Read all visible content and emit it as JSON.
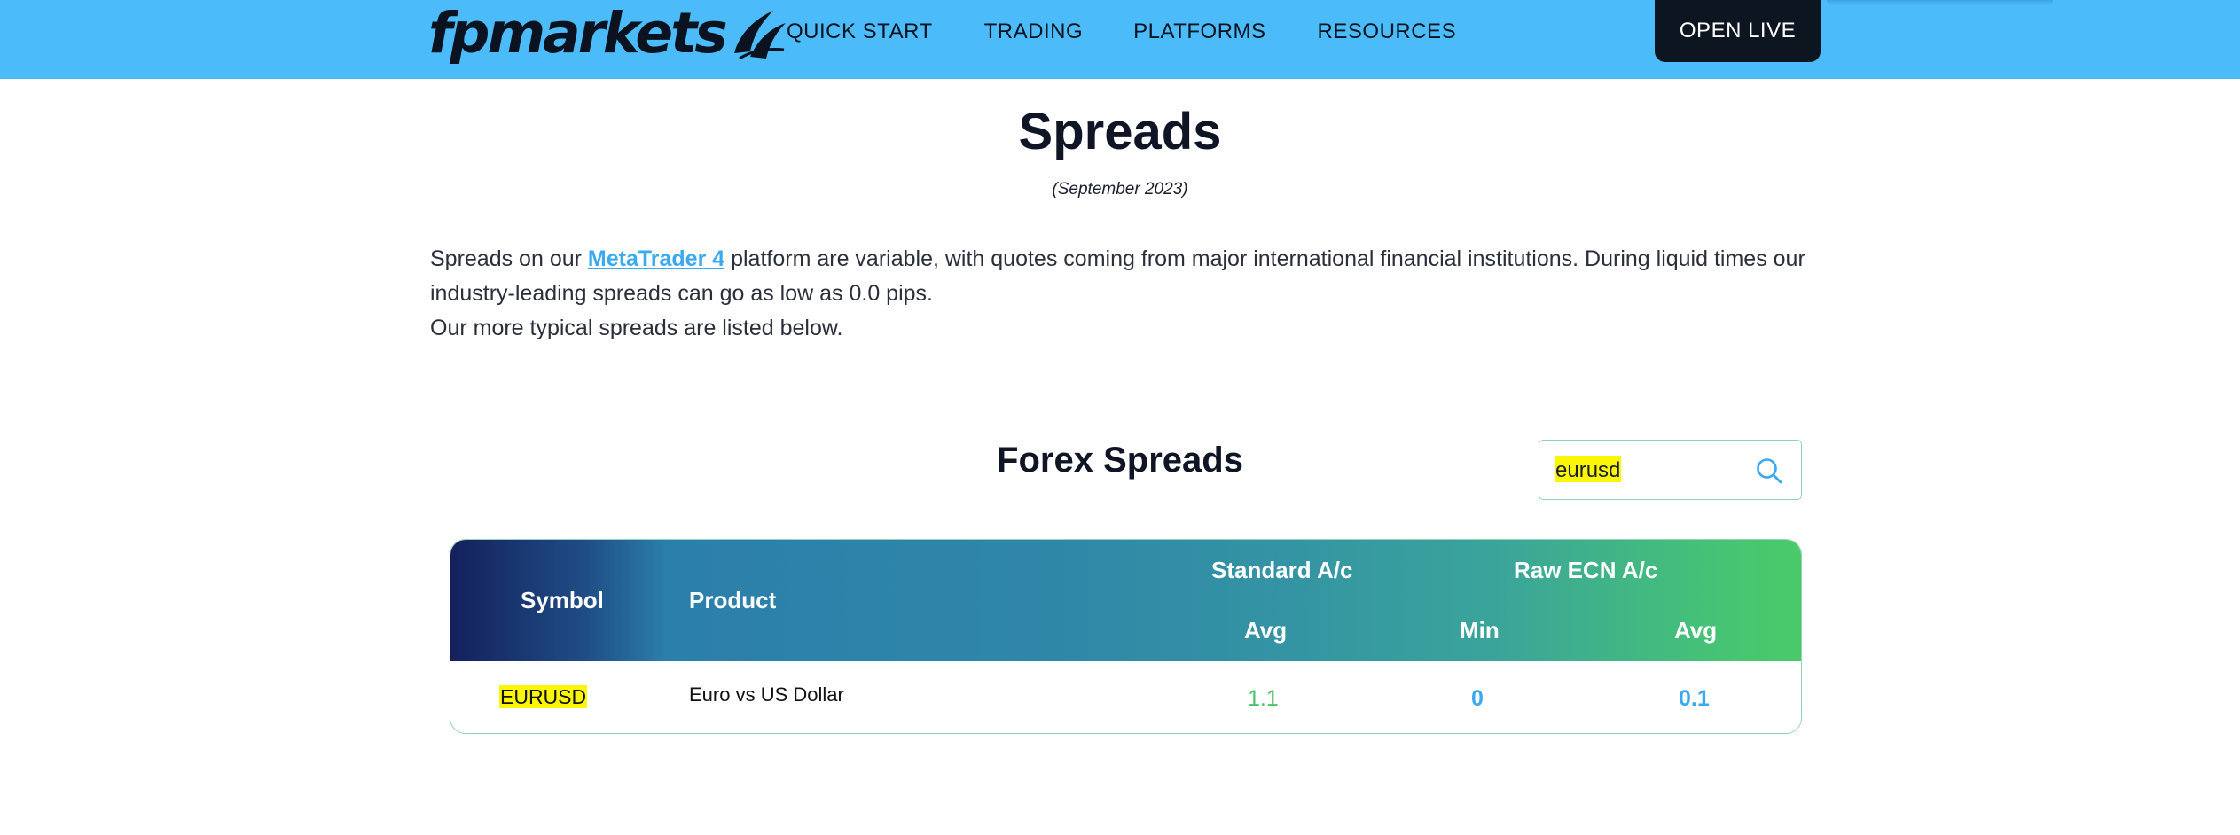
{
  "header": {
    "logo_text": "fpmarkets",
    "nav": [
      "QUICK START",
      "TRADING",
      "PLATFORMS",
      "RESOURCES"
    ],
    "cta_label": "OPEN LIVE",
    "color": "#4bbcf9"
  },
  "page": {
    "title": "Spreads",
    "date": "(September 2023)",
    "intro_before_link": "Spreads on our ",
    "intro_link": "MetaTrader 4",
    "intro_after_link": " platform are variable, with quotes coming from major international financial institutions. During liquid times our industry-leading spreads can go as low as 0.0 pips.",
    "intro_line2": "Our more typical spreads are listed below."
  },
  "forex": {
    "section_title": "Forex Spreads",
    "search_value": "eurusd",
    "search_icon": "search-icon",
    "columns": {
      "symbol": "Symbol",
      "product": "Product",
      "standard_group": "Standard A/c",
      "raw_group": "Raw ECN A/c",
      "standard_avg": "Avg",
      "raw_min": "Min",
      "raw_avg": "Avg"
    },
    "rows": [
      {
        "symbol": "EURUSD",
        "product": "Euro vs US Dollar",
        "standard_avg": "1.1",
        "raw_min": "0",
        "raw_avg": "0.1"
      }
    ]
  }
}
